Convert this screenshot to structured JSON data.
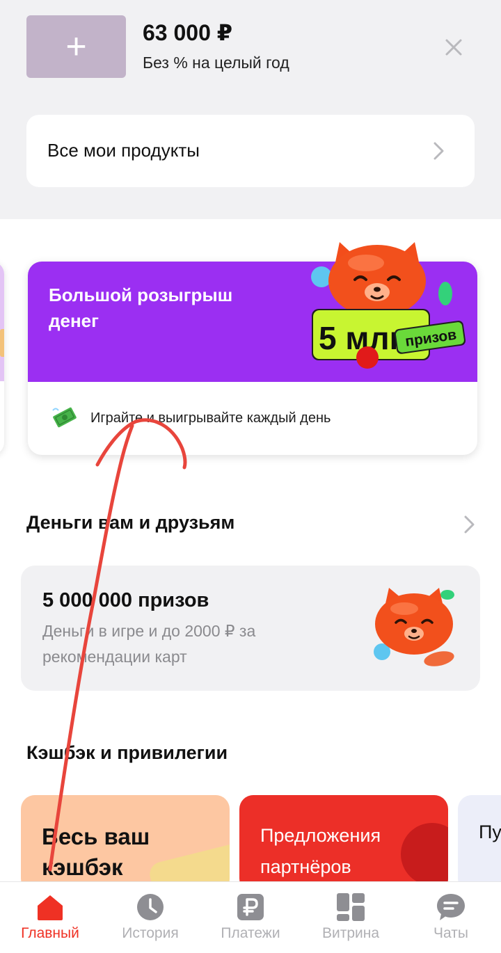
{
  "promo": {
    "amount": "63 000 ₽",
    "subtitle": "Без % на целый год",
    "thumb_icon": "plus-icon",
    "close_icon": "close-icon"
  },
  "products": {
    "label": "Все мои продукты",
    "chevron_icon": "chevron-right-icon"
  },
  "game_promo": {
    "title": "Большой розыгрыш денег",
    "badge_number": "5 млн",
    "badge_label": "призов",
    "subtitle": "Играйте и выигрывайте каждый день",
    "row_icon": "money-icon",
    "banner_color": "#9b2ff2"
  },
  "friends": {
    "title": "Деньги вам и друзьям",
    "chevron_icon": "chevron-right-icon",
    "card_title": "5 000 000 призов",
    "card_description": "Деньги в игре и до 2000 ₽ за рекомендации карт"
  },
  "cashback": {
    "title": "Кэшбэк и привилегии",
    "cards": [
      {
        "label": "Весь ваш кэшбэк",
        "color": "#fdc7a2"
      },
      {
        "label": "Предложения партнёров",
        "color": "#ec2f28"
      },
      {
        "label": "Пу",
        "color": "#eceef9"
      }
    ]
  },
  "bottom_nav": {
    "items": [
      {
        "label": "Главный",
        "icon": "home-icon",
        "active": true
      },
      {
        "label": "История",
        "icon": "clock-icon",
        "active": false
      },
      {
        "label": "Платежи",
        "icon": "ruble-icon",
        "active": false
      },
      {
        "label": "Витрина",
        "icon": "grid-icon",
        "active": false
      },
      {
        "label": "Чаты",
        "icon": "chat-icon",
        "active": false
      }
    ],
    "active_color": "#ef3124",
    "inactive_color": "#b0b0b4"
  },
  "colors": {
    "accent_red": "#ef3124",
    "purple": "#9b2ff2",
    "annotation_red": "#e8453c"
  }
}
